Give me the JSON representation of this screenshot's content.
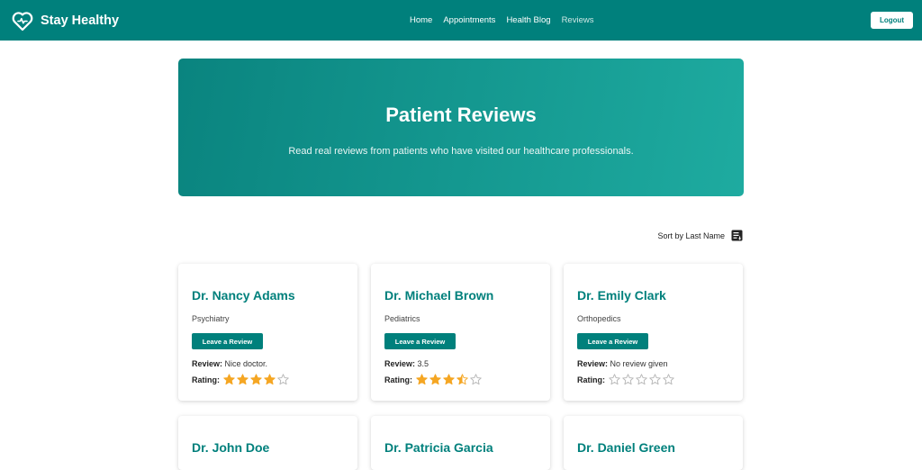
{
  "navbar": {
    "brand": "Stay Healthy",
    "links": [
      "Home",
      "Appointments",
      "Health Blog",
      "Reviews"
    ],
    "logout_label": "Logout",
    "color": "#00807c"
  },
  "hero": {
    "title": "Patient Reviews",
    "subtitle": "Read real reviews from patients who have visited our healthcare professionals."
  },
  "sort": {
    "label": "Sort by Last Name",
    "icon": "sort-list-icon"
  },
  "labels": {
    "leave_review": "Leave a Review",
    "review": "Review:",
    "rating": "Rating:"
  },
  "doctors": [
    {
      "name": "Dr. Nancy Adams",
      "specialty": "Psychiatry",
      "review": "Nice doctor.",
      "rating": 4
    },
    {
      "name": "Dr. Michael Brown",
      "specialty": "Pediatrics",
      "review": "3.5",
      "rating": 3.5
    },
    {
      "name": "Dr. Emily Clark",
      "specialty": "Orthopedics",
      "review": "No review given",
      "rating": 0
    },
    {
      "name": "Dr. John Doe"
    },
    {
      "name": "Dr. Patricia Garcia"
    },
    {
      "name": "Dr. Daniel Green"
    }
  ],
  "colors": {
    "accent": "#00807c",
    "star": "#f5a623",
    "star_empty": "#b5b5b5"
  }
}
